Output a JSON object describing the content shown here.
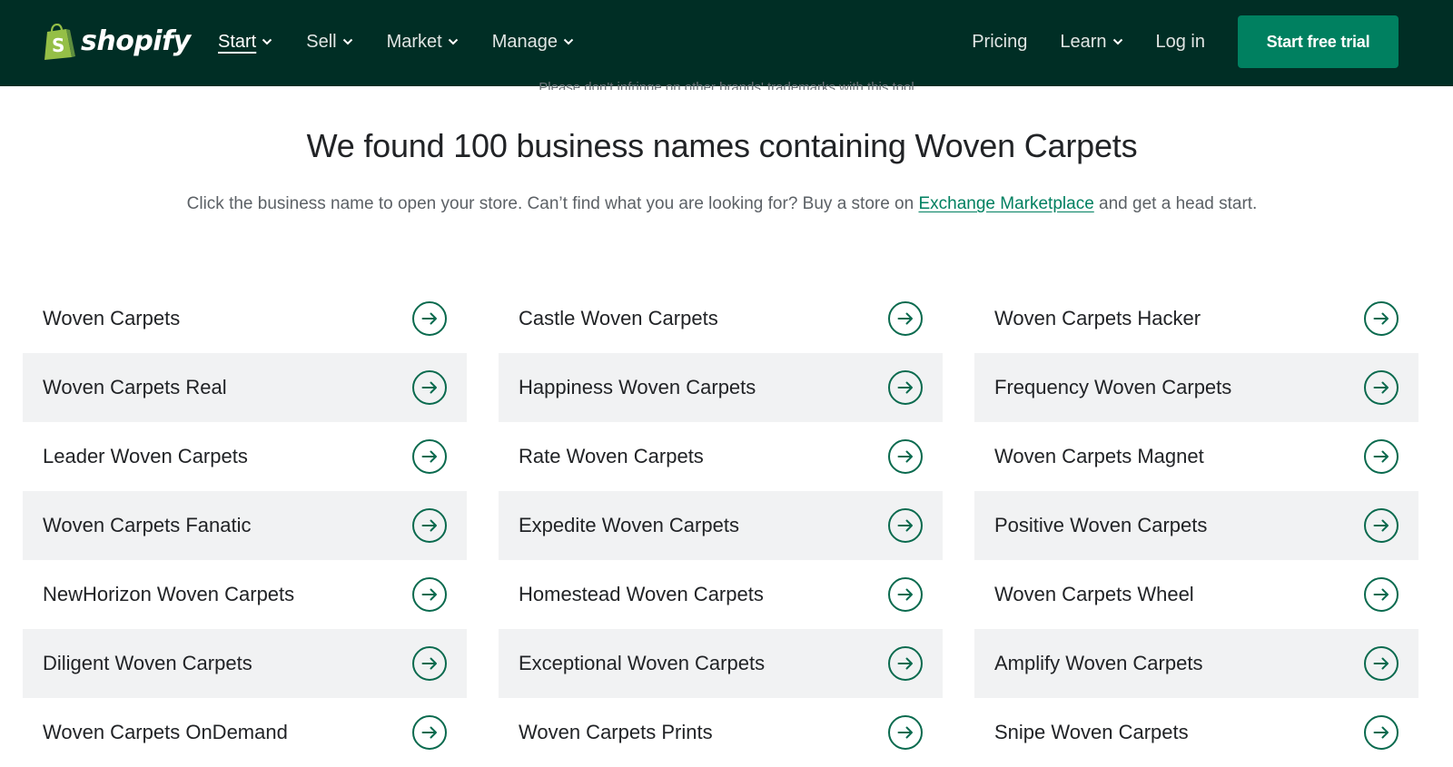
{
  "brand": {
    "name": "shopify",
    "accent": "#008060",
    "header_bg": "#002e25"
  },
  "nav": {
    "left": [
      {
        "label": "Start",
        "active": true,
        "has_dropdown": true
      },
      {
        "label": "Sell",
        "active": false,
        "has_dropdown": true
      },
      {
        "label": "Market",
        "active": false,
        "has_dropdown": true
      },
      {
        "label": "Manage",
        "active": false,
        "has_dropdown": true
      }
    ],
    "right": {
      "pricing": "Pricing",
      "learn": "Learn",
      "login": "Log in",
      "cta": "Start free trial"
    }
  },
  "page": {
    "clipped_note": "Please don't infringe on other brands' trademarks with this tool",
    "headline": "We found 100 business names containing Woven Carpets",
    "sub_before": "Click the business name to open your store. Can’t find what you are looking for? Buy a store on",
    "sub_link": "Exchange Marketplace",
    "sub_after": "and get a head start."
  },
  "results": [
    [
      "Woven Carpets",
      "Castle Woven Carpets",
      "Woven Carpets Hacker"
    ],
    [
      "Woven Carpets Real",
      "Happiness Woven Carpets",
      "Frequency Woven Carpets"
    ],
    [
      "Leader Woven Carpets",
      "Rate Woven Carpets",
      "Woven Carpets Magnet"
    ],
    [
      "Woven Carpets Fanatic",
      "Expedite Woven Carpets",
      "Positive Woven Carpets"
    ],
    [
      "NewHorizon Woven Carpets",
      "Homestead Woven Carpets",
      "Woven Carpets Wheel"
    ],
    [
      "Diligent Woven Carpets",
      "Exceptional Woven Carpets",
      "Amplify Woven Carpets"
    ],
    [
      "Woven Carpets OnDemand",
      "Woven Carpets Prints",
      "Snipe Woven Carpets"
    ]
  ],
  "icons": {
    "row_action": "arrow-right-circle-icon",
    "dropdown": "chevron-down-icon",
    "logo": "shopping-bag-icon"
  }
}
